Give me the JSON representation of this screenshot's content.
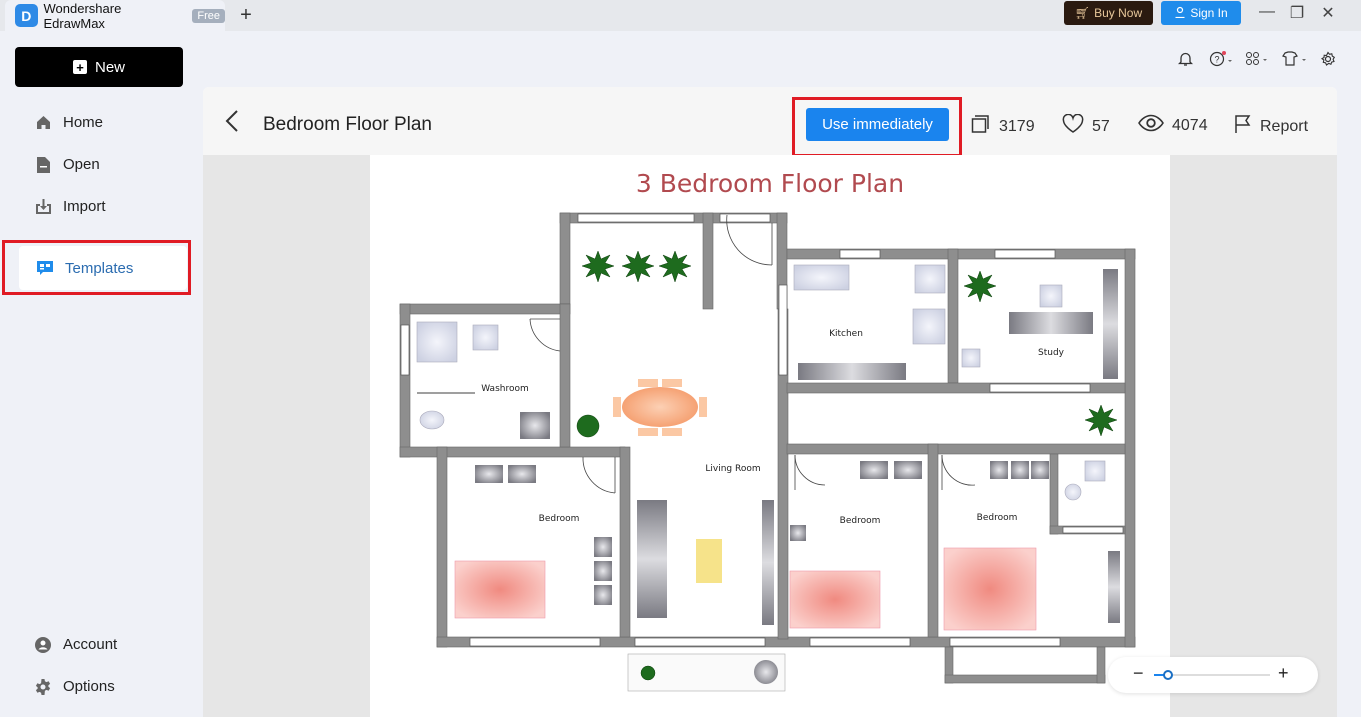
{
  "titlebar": {
    "app_name": "Wondershare EdrawMax",
    "badge": "Free",
    "new_tab_symbol": "+",
    "buy_now": "Buy Now",
    "sign_in": "Sign In",
    "window_controls": [
      "minimize",
      "restore",
      "close"
    ]
  },
  "toolbar_icons": [
    "bell-icon",
    "help-icon",
    "apps-icon",
    "theme-shirt-icon",
    "settings-icon"
  ],
  "sidebar": {
    "new_label": "New",
    "items": [
      {
        "label": "Home",
        "icon": "home-icon"
      },
      {
        "label": "Open",
        "icon": "file-icon"
      },
      {
        "label": "Import",
        "icon": "import-icon"
      },
      {
        "label": "Templates",
        "icon": "templates-icon",
        "active": true
      }
    ],
    "bottom_items": [
      {
        "label": "Account",
        "icon": "account-icon"
      },
      {
        "label": "Options",
        "icon": "gear-icon"
      }
    ]
  },
  "template_view": {
    "title": "Bedroom Floor Plan",
    "use_button": "Use immediately",
    "copies": "3179",
    "likes": "57",
    "views": "4074",
    "report": "Report"
  },
  "floorplan": {
    "title": "3 Bedroom Floor Plan",
    "title_color": "#b14a4f",
    "rooms": [
      {
        "label": "Washroom"
      },
      {
        "label": "Kitchen"
      },
      {
        "label": "Study"
      },
      {
        "label": "Living Room"
      },
      {
        "label": "Bedroom"
      },
      {
        "label": "Bedroom"
      },
      {
        "label": "Bedroom"
      }
    ]
  },
  "zoom": {
    "minus": "−",
    "plus": "+",
    "level_fraction": 0.1
  },
  "colors": {
    "accent": "#1a84ee",
    "highlight_box": "#e01b24",
    "buy_now_bg": "#2a1a10"
  }
}
